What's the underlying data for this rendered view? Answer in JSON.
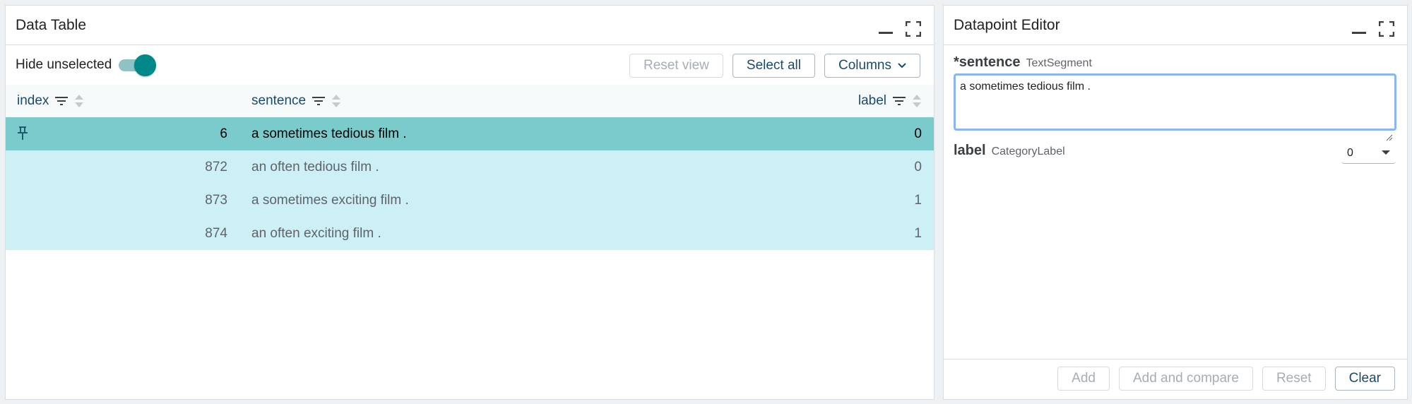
{
  "data_table": {
    "title": "Data Table",
    "hide_unselected_label": "Hide unselected",
    "hide_unselected_on": true,
    "buttons": {
      "reset_view": "Reset view",
      "select_all": "Select all",
      "columns": "Columns"
    },
    "columns": [
      "index",
      "sentence",
      "label"
    ],
    "rows": [
      {
        "index": "6",
        "sentence": "a sometimes tedious film .",
        "label": "0",
        "selected": true,
        "pinned": true
      },
      {
        "index": "872",
        "sentence": "an often tedious film .",
        "label": "0"
      },
      {
        "index": "873",
        "sentence": "a sometimes exciting film .",
        "label": "1"
      },
      {
        "index": "874",
        "sentence": "an often exciting film .",
        "label": "1"
      }
    ]
  },
  "editor": {
    "title": "Datapoint Editor",
    "sentence_field": {
      "name": "*sentence",
      "type": "TextSegment",
      "value": "a sometimes tedious film ."
    },
    "label_field": {
      "name": "label",
      "type": "CategoryLabel",
      "value": "0"
    },
    "buttons": {
      "add": "Add",
      "add_and_compare": "Add and compare",
      "reset": "Reset",
      "clear": "Clear"
    }
  },
  "colors": {
    "accent": "#00878a",
    "selected_row": "#7ccbcc",
    "related_row": "#cdf0f7"
  }
}
